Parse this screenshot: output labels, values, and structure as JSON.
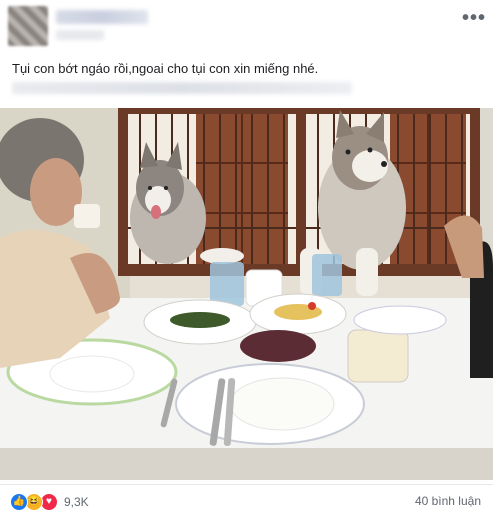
{
  "post": {
    "caption": "Tụi con bớt ngáo rồi,ngoai cho tụi con xin miếng nhé.",
    "more_icon": "more-horizontal-icon"
  },
  "footer": {
    "reactions": [
      "like-icon",
      "haha-icon",
      "love-icon"
    ],
    "reaction_count": "9,3K",
    "comment_count": "40 bình luận"
  },
  "colors": {
    "like": "#1877f2",
    "haha": "#f7b125",
    "love": "#f02849"
  }
}
